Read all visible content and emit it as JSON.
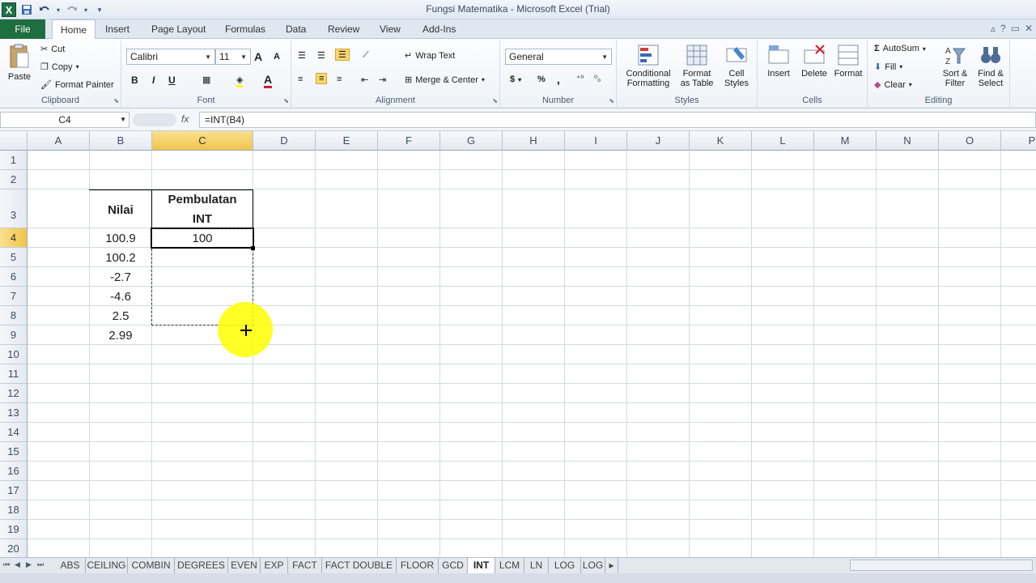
{
  "window": {
    "title": "Fungsi Matematika - Microsoft Excel (Trial)",
    "qat_icons": [
      "excel-logo",
      "save-icon",
      "undo-icon",
      "redo-icon",
      "customize-icon"
    ]
  },
  "tabs": {
    "file": "File",
    "items": [
      "Home",
      "Insert",
      "Page Layout",
      "Formulas",
      "Data",
      "Review",
      "View",
      "Add-Ins"
    ],
    "active": "Home"
  },
  "ribbon": {
    "clipboard": {
      "label": "Clipboard",
      "paste": "Paste",
      "cut": "Cut",
      "copy": "Copy",
      "format_painter": "Format Painter"
    },
    "font": {
      "label": "Font",
      "font_name": "Calibri",
      "font_size": "11",
      "bold": "B",
      "italic": "I",
      "underline": "U",
      "grow": "A",
      "shrink": "A"
    },
    "alignment": {
      "label": "Alignment",
      "wrap_text": "Wrap Text",
      "merge_center": "Merge & Center"
    },
    "number": {
      "label": "Number",
      "format": "General",
      "currency": "$",
      "percent": "%",
      "comma": ","
    },
    "styles": {
      "label": "Styles",
      "conditional_1": "Conditional",
      "conditional_2": "Formatting",
      "format_table_1": "Format",
      "format_table_2": "as Table",
      "cell_styles_1": "Cell",
      "cell_styles_2": "Styles"
    },
    "cells": {
      "label": "Cells",
      "insert": "Insert",
      "delete": "Delete",
      "format": "Format"
    },
    "editing": {
      "label": "Editing",
      "autosum": "AutoSum",
      "fill": "Fill",
      "clear": "Clear",
      "sort_1": "Sort &",
      "sort_2": "Filter",
      "find_1": "Find &",
      "find_2": "Select"
    }
  },
  "formula_bar": {
    "name_box": "C4",
    "fx": "fx",
    "formula": "=INT(B4)"
  },
  "columns": [
    "A",
    "B",
    "C",
    "D",
    "E",
    "F",
    "G",
    "H",
    "I",
    "J",
    "K",
    "L",
    "M",
    "N",
    "O",
    "P"
  ],
  "rows": [
    "1",
    "2",
    "3",
    "4",
    "5",
    "6",
    "7",
    "8",
    "9",
    "10",
    "11",
    "12",
    "13",
    "14",
    "15",
    "16",
    "17",
    "18",
    "19",
    "20"
  ],
  "cells": {
    "b3": "Nilai",
    "c3_line1": "Pembulatan",
    "c3_line2": "INT",
    "b_values": [
      "100.9",
      "100.2",
      "-2.7",
      "-4.6",
      "2.5",
      "2.99"
    ],
    "c4": "100"
  },
  "sheets": [
    "ABS",
    "CEILING",
    "COMBIN",
    "DEGREES",
    "EVEN",
    "EXP",
    "FACT",
    "FACT DOUBLE",
    "FLOOR",
    "GCD",
    "INT",
    "LCM",
    "LN",
    "LOG",
    "LOG"
  ],
  "active_sheet": "INT",
  "colors": {
    "accent": "#1f6e3f",
    "selection_header": "#f1c44b",
    "highlight": "#ffff00"
  }
}
